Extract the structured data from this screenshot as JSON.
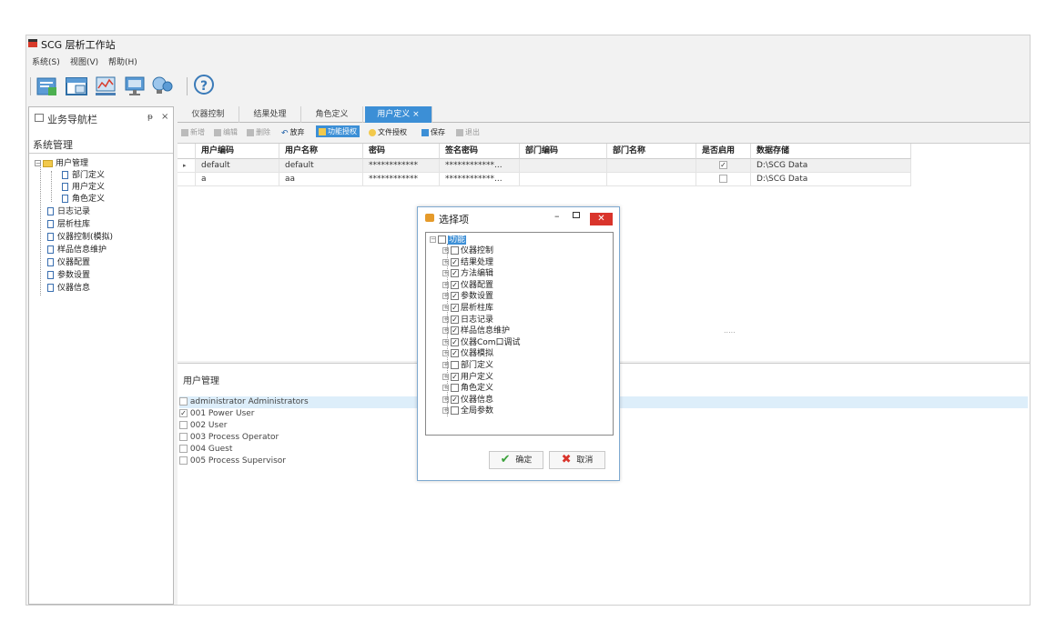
{
  "app": {
    "title": "SCG 层析工作站"
  },
  "menu": [
    "系统(S)",
    "视图(V)",
    "帮助(H)"
  ],
  "toolbar": {
    "icons": [
      "config-icon",
      "window-icon",
      "chart-icon",
      "monitor-icon",
      "bulb-icon",
      "help-icon"
    ],
    "help_label": "?"
  },
  "nav": {
    "header": "业务导航栏",
    "pin": "ᵽ",
    "close": "×",
    "section": "系统管理",
    "root": "用户管理",
    "children": [
      "部门定义",
      "用户定义",
      "角色定义"
    ],
    "items": [
      "日志记录",
      "层析柱库",
      "仪器控制(模拟)",
      "样品信息维护",
      "仪器配置",
      "参数设置",
      "仪器信息"
    ]
  },
  "tabs": [
    {
      "label": "仪器控制"
    },
    {
      "label": "结果处理"
    },
    {
      "label": "角色定义"
    },
    {
      "label": "用户定义 ×"
    }
  ],
  "subtoolbar": [
    "新增",
    "编辑",
    "删除",
    "放弃",
    "功能授权",
    "文件授权",
    "保存",
    "退出"
  ],
  "grid": {
    "columns": [
      "用户编码",
      "用户名称",
      "密码",
      "签名密码",
      "部门编码",
      "部门名称",
      "是否启用",
      "数据存储"
    ],
    "rows": [
      {
        "marker": "▸",
        "code": "default",
        "name": "default",
        "password": "************",
        "sign": "************...",
        "dept_code": "",
        "dept_name": "",
        "enabled": true,
        "storage": "D:\\SCG Data"
      },
      {
        "marker": "",
        "code": "a",
        "name": "aa",
        "password": "************",
        "sign": "************...",
        "dept_code": "",
        "dept_name": "",
        "enabled": false,
        "storage": "D:\\SCG Data"
      }
    ]
  },
  "lower": {
    "title": "用户管理",
    "splitter": ".....",
    "roles": [
      {
        "label": "administrator Administrators",
        "checked": false
      },
      {
        "label": "001 Power User",
        "checked": true
      },
      {
        "label": "002 User",
        "checked": false
      },
      {
        "label": "003 Process Operator",
        "checked": false
      },
      {
        "label": "004 Guest",
        "checked": false
      },
      {
        "label": "005 Process Supervisor",
        "checked": false
      }
    ]
  },
  "dialog": {
    "title": "选择项",
    "min": "–",
    "close": "✕",
    "root": "功能",
    "items": [
      {
        "label": "仪器控制",
        "checked": false
      },
      {
        "label": "结果处理",
        "checked": true
      },
      {
        "label": "方法编辑",
        "checked": true
      },
      {
        "label": "仪器配置",
        "checked": true
      },
      {
        "label": "参数设置",
        "checked": true
      },
      {
        "label": "层析柱库",
        "checked": true
      },
      {
        "label": "日志记录",
        "checked": true
      },
      {
        "label": "样品信息维护",
        "checked": true
      },
      {
        "label": "仪器Com口调试",
        "checked": true
      },
      {
        "label": "仪器模拟",
        "checked": true
      },
      {
        "label": "部门定义",
        "checked": false
      },
      {
        "label": "用户定义",
        "checked": true
      },
      {
        "label": "角色定义",
        "checked": false
      },
      {
        "label": "仪器信息",
        "checked": true
      },
      {
        "label": "全局参数",
        "checked": false
      }
    ],
    "ok": "确定",
    "cancel": "取消"
  }
}
